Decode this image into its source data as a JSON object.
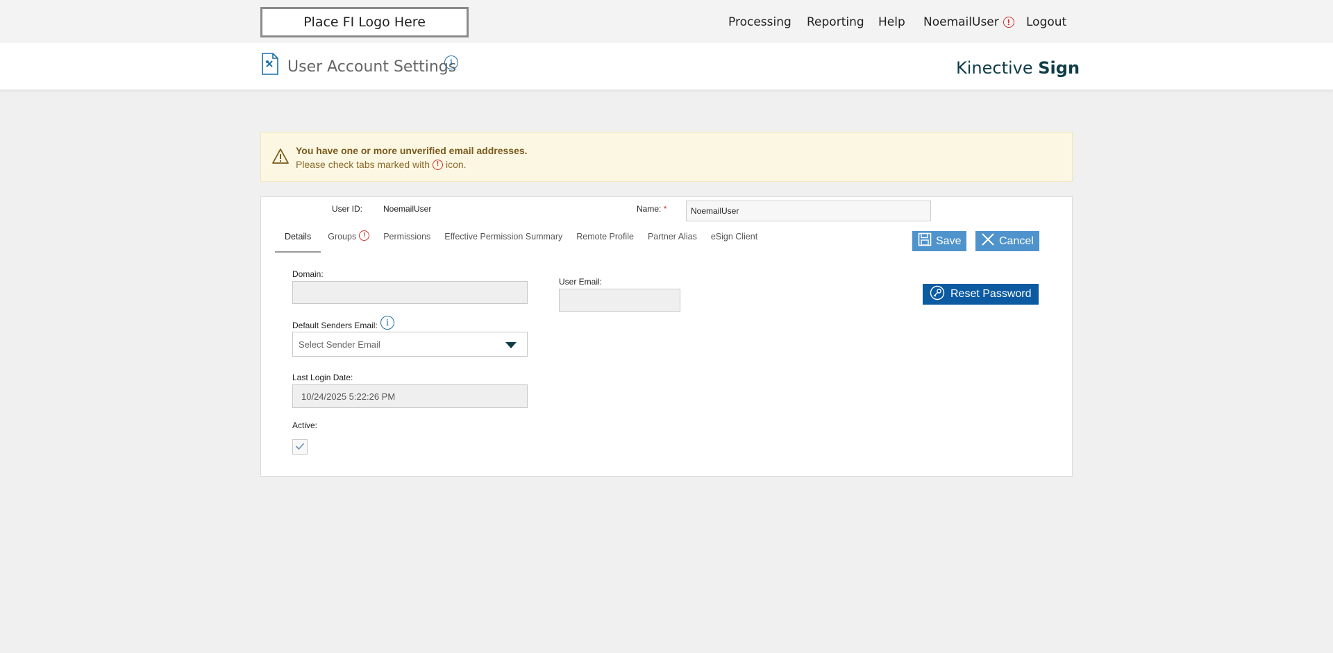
{
  "topnav": {
    "logo_placeholder": "Place FI Logo Here",
    "items": [
      {
        "label": "Processing"
      },
      {
        "label": "Reporting"
      },
      {
        "label": "Help"
      },
      {
        "label": "NoemailUser"
      },
      {
        "label": "Logout"
      }
    ],
    "alert_glyph": "!"
  },
  "header": {
    "title": "User Account Settings",
    "brand_light": "Kinective",
    "brand_bold": "Sign"
  },
  "warning": {
    "title": "You have one or more unverified email addresses.",
    "text_before": "Please check tabs marked with",
    "text_after": "icon."
  },
  "user": {
    "id_label": "User ID:",
    "id_value": "NoemailUser",
    "name_label": "Name:",
    "name_required": "*",
    "name_value": "NoemailUser"
  },
  "tabs": [
    {
      "label": "Details",
      "active": true
    },
    {
      "label": "Groups",
      "alert": true
    },
    {
      "label": "Permissions"
    },
    {
      "label": "Effective Permission Summary"
    },
    {
      "label": "Remote Profile"
    },
    {
      "label": "Partner Alias"
    },
    {
      "label": "eSign Client"
    }
  ],
  "buttons": {
    "save": "Save",
    "cancel": "Cancel",
    "reset_password": "Reset Password"
  },
  "form": {
    "domain_label": "Domain:",
    "domain_value": "",
    "user_email_label": "User Email:",
    "user_email_value": "",
    "default_senders_label": "Default Senders Email:",
    "default_senders_placeholder": "Select Sender Email",
    "last_login_label": "Last Login Date:",
    "last_login_value": "10/24/2025 5:22:26 PM",
    "active_label": "Active:",
    "active_checked": true
  },
  "colors": {
    "accent_blue": "#4f93cc",
    "dark_blue": "#0b5aa2",
    "alert_red": "#d0312d",
    "warning_bg": "#fcf7e3",
    "brand": "#0f3d47"
  }
}
